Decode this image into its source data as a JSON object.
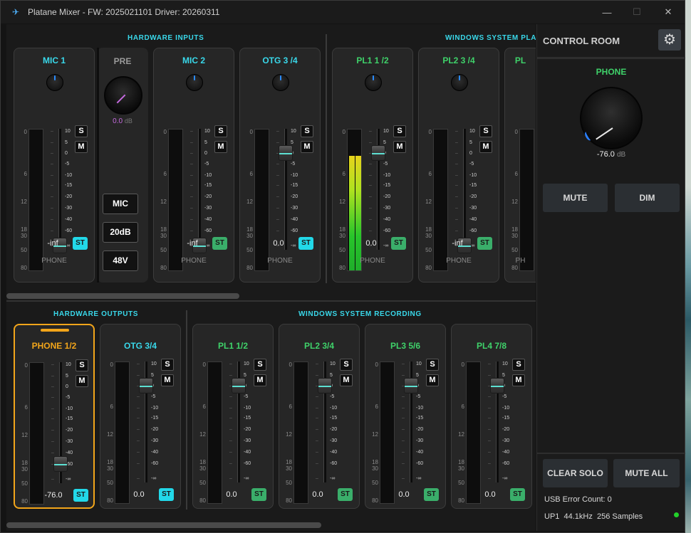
{
  "window": {
    "title": "Platane Mixer - FW: 2025021101 Driver: 20260311",
    "minimize_glyph": "—",
    "maximize_glyph": "☐",
    "close_glyph": "✕"
  },
  "sections": {
    "hardware_inputs": "HARDWARE INPUTS",
    "windows_playback": "WINDOWS SYSTEM PLAY",
    "hardware_outputs": "HARDWARE OUTPUTS",
    "windows_recording": "WINDOWS SYSTEM RECORDING"
  },
  "meter_scale": [
    "0",
    "6",
    "12",
    "18",
    "30",
    "50",
    "80"
  ],
  "fader_scale": [
    "10",
    "5",
    "0",
    "-5",
    "-10",
    "-15",
    "-20",
    "-30",
    "-40",
    "-60",
    "-∞"
  ],
  "labels": {
    "solo": "S",
    "mute": "M",
    "stereo": "ST"
  },
  "inputs": [
    {
      "name": "MIC 1",
      "value": "-inf",
      "device": "PHONE",
      "st_on": true,
      "fader_db": "-∞",
      "level": 0
    },
    {
      "name": "MIC 2",
      "value": "-inf",
      "device": "PHONE",
      "st_on": false,
      "fader_db": "-∞",
      "level": 0
    },
    {
      "name": "OTG 3 /4",
      "value": "0.0",
      "device": "PHONE",
      "st_on": true,
      "fader_db": "0",
      "level": 0
    }
  ],
  "pre": {
    "title": "PRE",
    "value": "0.0",
    "unit": "dB",
    "buttons": [
      "MIC",
      "20dB",
      "48V"
    ]
  },
  "playback": [
    {
      "name": "PL1 1 /2",
      "value": "0.0",
      "device": "PHONE",
      "st_on": false,
      "fader_db": "0",
      "level": 0.82
    },
    {
      "name": "PL2 3 /4",
      "value": "-inf",
      "device": "PHONE",
      "st_on": false,
      "fader_db": "-∞",
      "level": 0
    },
    {
      "name": "PL",
      "value": "",
      "device": "PH",
      "st_on": false,
      "fader_db": "0",
      "level": 0
    }
  ],
  "outputs": [
    {
      "name": "PHONE 1/2",
      "value": "-76.0",
      "st_on": true,
      "fader_db": "-60",
      "selected": true
    },
    {
      "name": "OTG 3/4",
      "value": "0.0",
      "st_on": true,
      "fader_db": "0",
      "selected": false
    }
  ],
  "recording": [
    {
      "name": "PL1 1/2",
      "value": "0.0",
      "st_on": false,
      "fader_db": "0"
    },
    {
      "name": "PL2 3/4",
      "value": "0.0",
      "st_on": false,
      "fader_db": "0"
    },
    {
      "name": "PL3 5/6",
      "value": "0.0",
      "st_on": false,
      "fader_db": "0"
    },
    {
      "name": "PL4 7/8",
      "value": "0.0",
      "st_on": false,
      "fader_db": "0"
    }
  ],
  "control_room": {
    "title": "CONTROL ROOM",
    "output_label": "PHONE",
    "volume": "-76.0",
    "unit": "dB",
    "mute_label": "MUTE",
    "dim_label": "DIM",
    "clear_solo_label": "CLEAR SOLO",
    "mute_all_label": "MUTE ALL",
    "usb_error_label": "USB Error Count: 0",
    "status_label": "UP1  44.1kHz  256 Samples",
    "status_color": "#22d12a"
  },
  "colors": {
    "accent_cyan": "#39d8ea",
    "accent_green": "#3fd26a",
    "selected_orange": "#f2a51a",
    "pre_purple": "#c66be0"
  }
}
